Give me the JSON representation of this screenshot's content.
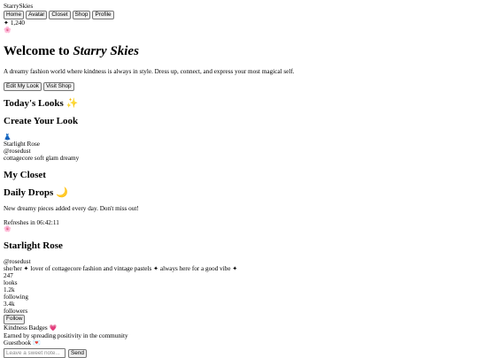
{
  "app": {
    "title": "StarrySkies",
    "nav": [
      "Home",
      "Avatar",
      "Closet",
      "Shop",
      "Profile"
    ],
    "currency": "✦ 1,240",
    "avatar_icon": "🌸"
  },
  "hero": {
    "title_prefix": "Welcome to ",
    "title_emph": "Starry Skies",
    "subtitle": "A dreamy fashion world where kindness is always in style. Dress up, connect, and express your most magical self.",
    "edit_label": "Edit My Look",
    "shop_label": "Visit Shop"
  },
  "sections": {
    "todays_looks": "Today's Looks ✨",
    "create_look": "Create Your Look",
    "my_closet": "My Closet",
    "daily_drops": "Daily Drops 🌙"
  },
  "look_card": {
    "icon": "👗",
    "name": "Starlight Rose",
    "handle": "@rosedust",
    "tags": "cottagecore soft glam dreamy"
  },
  "drops": {
    "desc": "New dreamy pieces added every day. Don't miss out!",
    "refresh": "Refreshes in 06:42:11",
    "icon": "🌸"
  },
  "profile": {
    "name": "Starlight Rose",
    "handle": "@rosedust",
    "bio": "she/her ✦ lover of cottagecore fashion and vintage pastels ✦ always here for a good vibe ✦",
    "looks_count": "247",
    "looks_label": "looks",
    "following_count": "1.2k",
    "following_label": "following",
    "followers_count": "3.4k",
    "followers_label": "followers",
    "follow_label": "Follow",
    "badges_label": "Kindness Badges",
    "badges_icon": "💗",
    "badges_desc": "Earned by spreading positivity in the community",
    "guestbook_label": "Guestbook",
    "guestbook_icon": "💌",
    "note_placeholder": "Leave a sweet note...",
    "send_label": "Send"
  }
}
